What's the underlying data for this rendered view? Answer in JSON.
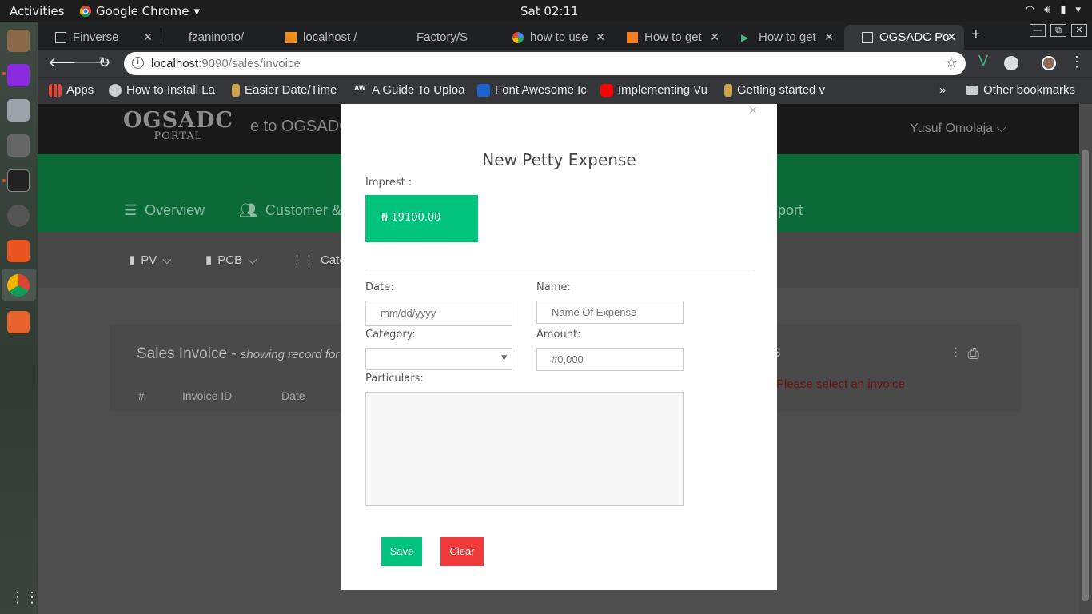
{
  "os": {
    "activities": "Activities",
    "app_name": "Google Chrome",
    "clock": "Sat 02:11"
  },
  "browser": {
    "tabs": [
      {
        "label": "Finverse"
      },
      {
        "label": "fzaninotto/"
      },
      {
        "label": "localhost /"
      },
      {
        "label": "Factory/S"
      },
      {
        "label": "how to use"
      },
      {
        "label": "How to get"
      },
      {
        "label": "How to get"
      },
      {
        "label": "OGSADC Po",
        "active": true
      }
    ],
    "url_host": "localhost",
    "url_rest": ":9090/sales/invoice",
    "bookmarks": [
      {
        "label": "Apps"
      },
      {
        "label": "How to Install La"
      },
      {
        "label": "Easier Date/Time"
      },
      {
        "label": "A Guide To Uploa"
      },
      {
        "label": "Font Awesome Ic"
      },
      {
        "label": "Implementing Vu"
      },
      {
        "label": "Getting started v"
      }
    ],
    "overflow": "»",
    "other_bookmarks": "Other bookmarks"
  },
  "app": {
    "logo_line1": "OGSADC",
    "logo_line2": "PORTAL",
    "welcome": "e to OGSADC",
    "user": "Yusuf Omolaja",
    "nav_overview": "Overview",
    "nav_customer": "Customer &",
    "nav_report": "port",
    "subnav_pv": "PV",
    "subnav_pcb": "PCB",
    "subnav_category": "Catego",
    "card_title": "Sales Invoice - ",
    "card_subtitle": "showing record for",
    "col_hash": "#",
    "col_invoice_id": "Invoice ID",
    "col_date": "Date",
    "right_s": "s",
    "error": "Please select an invoice"
  },
  "modal": {
    "close": "×",
    "title": "New Petty Expense",
    "imprest_label": "Imprest :",
    "imprest_value": "₦ 19100.00",
    "date_label": "Date:",
    "date_placeholder": "mm/dd/yyyy",
    "name_label": "Name:",
    "name_placeholder": "Name Of Expense",
    "category_label": "Category:",
    "category_value": "",
    "amount_label": "Amount:",
    "amount_placeholder": "#0,000",
    "particulars_label": "Particulars:",
    "save": "Save",
    "clear": "Clear"
  },
  "colors": {
    "accent_green": "#00c47e",
    "danger_red": "#f23a3a"
  }
}
